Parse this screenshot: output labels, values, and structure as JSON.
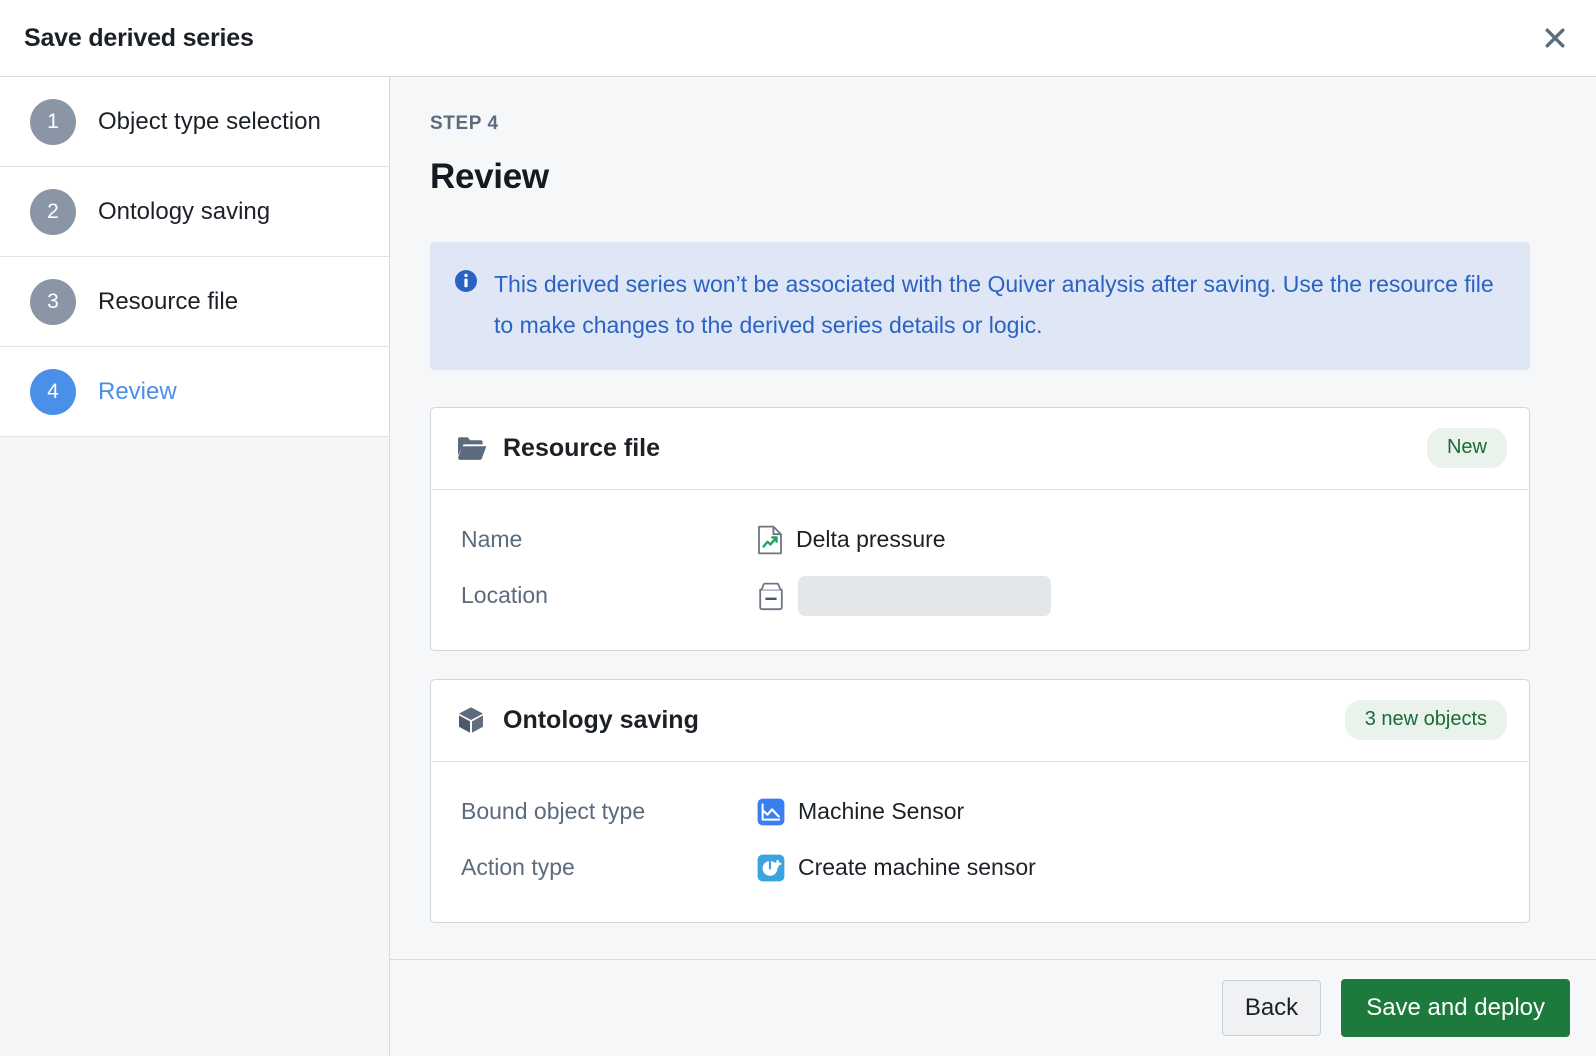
{
  "dialog": {
    "title": "Save derived series",
    "close_icon": "close-icon"
  },
  "sidebar": {
    "steps": [
      {
        "number": "1",
        "label": "Object type selection",
        "active": false
      },
      {
        "number": "2",
        "label": "Ontology saving",
        "active": false
      },
      {
        "number": "3",
        "label": "Resource file",
        "active": false
      },
      {
        "number": "4",
        "label": "Review",
        "active": true
      }
    ]
  },
  "main": {
    "eyebrow": "STEP 4",
    "title": "Review",
    "banner": {
      "icon": "info-circle-icon",
      "text": "This derived series won’t be associated with the Quiver analysis after saving. Use the resource file to make changes to the derived series details or logic."
    },
    "cards": [
      {
        "icon": "folder-icon",
        "title": "Resource file",
        "badge": "New",
        "rows": [
          {
            "label": "Name",
            "icon": "document-chart-icon",
            "value": "Delta pressure",
            "type": "text"
          },
          {
            "label": "Location",
            "icon": "file-box-icon",
            "value": "",
            "type": "placeholder"
          }
        ]
      },
      {
        "icon": "cube-icon",
        "title": "Ontology saving",
        "badge": "3 new objects",
        "rows": [
          {
            "label": "Bound object type",
            "icon": "chart-tile-icon",
            "value": "Machine Sensor",
            "type": "text"
          },
          {
            "label": "Action type",
            "icon": "create-action-tile-icon",
            "value": "Create machine sensor",
            "type": "text"
          }
        ]
      }
    ]
  },
  "footer": {
    "back_label": "Back",
    "save_label": "Save and deploy"
  },
  "colors": {
    "accent_blue": "#4a90e8",
    "banner_bg": "#dfe6f5",
    "banner_text": "#2a63c4",
    "badge_bg": "#e9f3ec",
    "badge_text": "#1a6b38",
    "primary_green": "#1d7a3d",
    "step_inactive": "#8a95a5"
  }
}
